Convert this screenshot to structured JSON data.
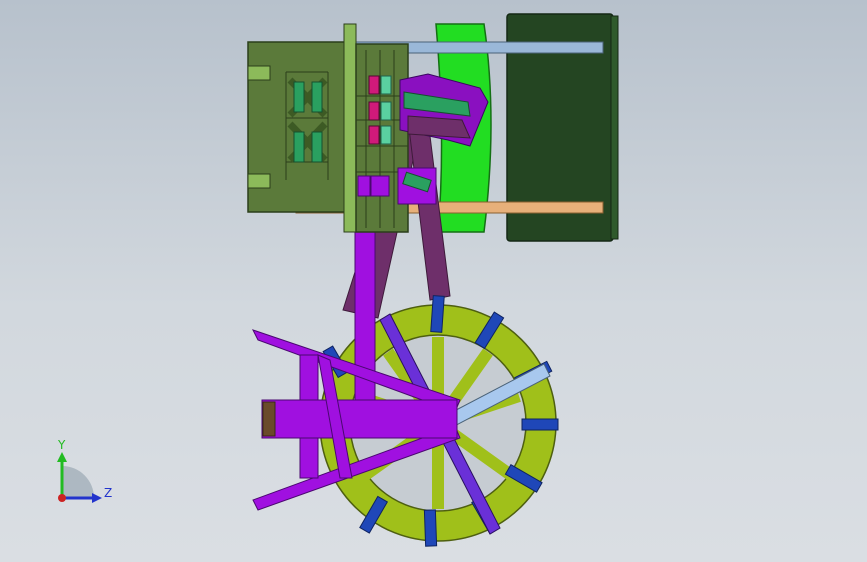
{
  "viewport": {
    "background_top": "#b7c1cc",
    "background_bottom": "#dadee3"
  },
  "triad": {
    "y_label": "Y",
    "z_label": "Z",
    "y_color": "#22bb22",
    "z_color": "#2233cc",
    "origin_color": "#cc2222"
  },
  "model": {
    "colors": {
      "frame_green": "#5b7a3a",
      "bright_green": "#22dd22",
      "dark_green_panel": "#244522",
      "light_blue_rail": "#9ab8d8",
      "tan_rail": "#e7b07a",
      "purple": "#a010e0",
      "dark_purple": "#6e2f6a",
      "wheel_yellow_green": "#a0c01a",
      "paddle_blue": "#1f47b8"
    }
  }
}
